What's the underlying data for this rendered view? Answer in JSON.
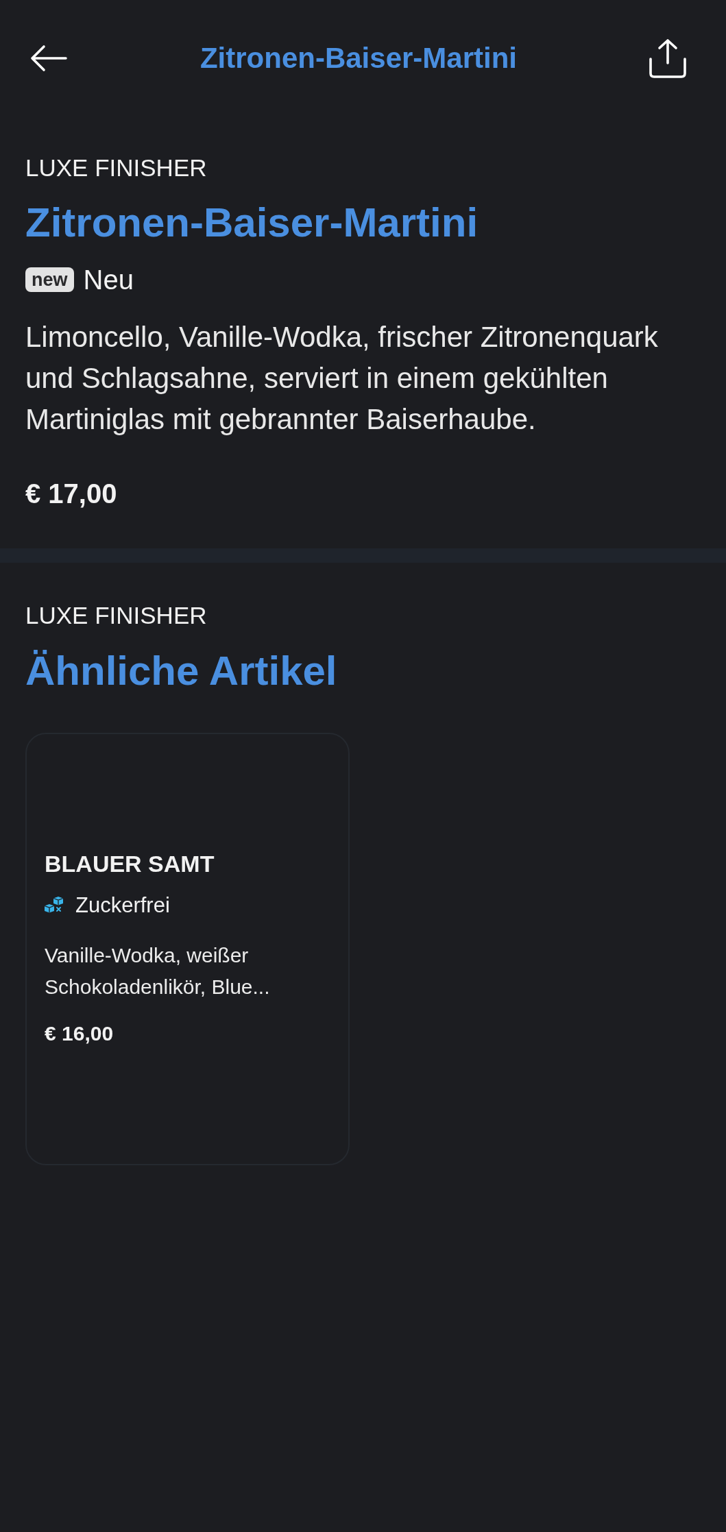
{
  "header": {
    "title": "Zitronen-Baiser-Martini"
  },
  "item": {
    "category": "LUXE FINISHER",
    "name": "Zitronen-Baiser-Martini",
    "badges": [
      {
        "kind": "new",
        "tag": "new",
        "label": "Neu"
      }
    ],
    "description": "Limoncello, Vanille-Wodka, frischer Zitronenquark und Schlagsahne, serviert in einem gekühlten Martiniglas mit gebrannter Baiserhaube.",
    "price": "€ 17,00"
  },
  "related": {
    "category": "LUXE FINISHER",
    "title": "Ähnliche Artikel",
    "items": [
      {
        "name": "BLAUER SAMT",
        "tags": [
          {
            "kind": "sugar_free",
            "label": "Zuckerfrei"
          }
        ],
        "description": "Vanille-Wodka, weißer Schokoladenlikör, Blue...",
        "price": "€ 16,00"
      }
    ]
  }
}
